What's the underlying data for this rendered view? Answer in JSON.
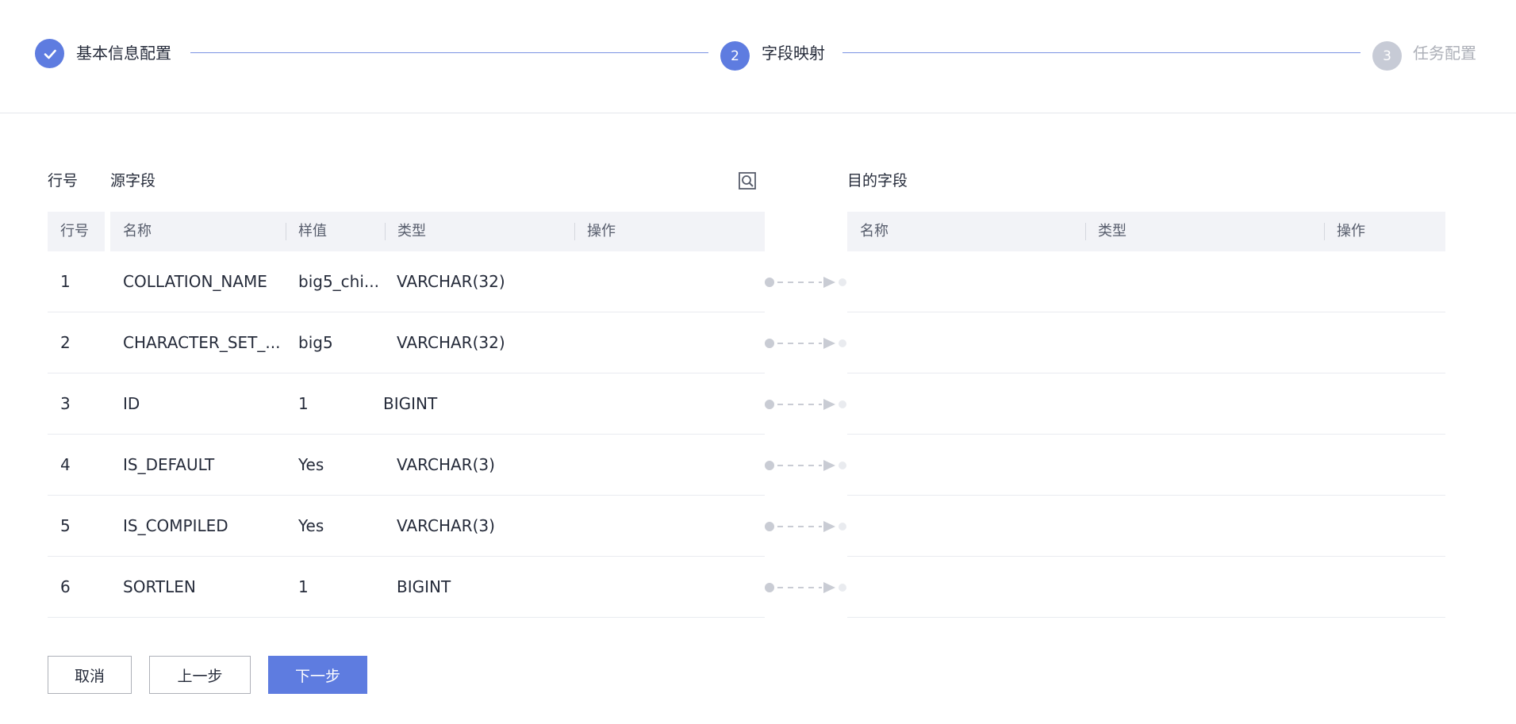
{
  "steps": [
    {
      "index": "1",
      "label": "基本信息配置",
      "state": "done"
    },
    {
      "index": "2",
      "label": "字段映射",
      "state": "active"
    },
    {
      "index": "3",
      "label": "任务配置",
      "state": "wait"
    }
  ],
  "source": {
    "row_title": "行号",
    "title": "源字段",
    "search_icon": "search-icon",
    "columns": {
      "row": "行号",
      "name": "名称",
      "sample": "样值",
      "type": "类型",
      "action": "操作"
    },
    "rows": [
      {
        "row": "1",
        "name": "COLLATION_NAME",
        "sample": "big5_chi...",
        "type": "VARCHAR(32)"
      },
      {
        "row": "2",
        "name": "CHARACTER_SET_...",
        "sample": "big5",
        "type": "VARCHAR(32)"
      },
      {
        "row": "3",
        "name": "ID",
        "sample": "1",
        "type": "BIGINT"
      },
      {
        "row": "4",
        "name": "IS_DEFAULT",
        "sample": "Yes",
        "type": "VARCHAR(3)"
      },
      {
        "row": "5",
        "name": "IS_COMPILED",
        "sample": "Yes",
        "type": "VARCHAR(3)"
      },
      {
        "row": "6",
        "name": "SORTLEN",
        "sample": "1",
        "type": "BIGINT"
      }
    ]
  },
  "target": {
    "title": "目的字段",
    "columns": {
      "name": "名称",
      "type": "类型",
      "action": "操作"
    }
  },
  "buttons": {
    "cancel": "取消",
    "prev": "上一步",
    "next": "下一步"
  },
  "colors": {
    "accent": "#5e7ce0",
    "step_wait": "#c7cbd6",
    "header_bg": "#f2f3f7"
  }
}
